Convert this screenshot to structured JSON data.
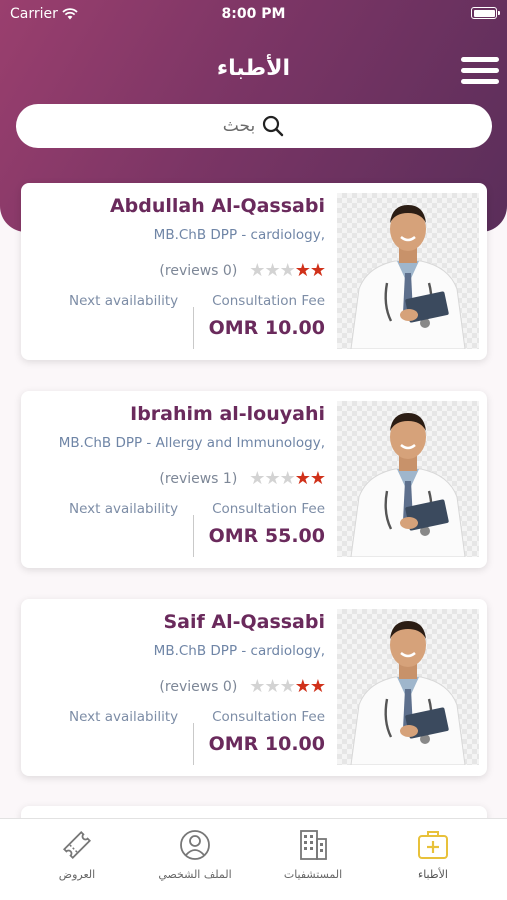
{
  "status_bar": {
    "carrier": "Carrier",
    "time": "8:00 PM"
  },
  "header": {
    "title": "الأطباء",
    "menu_icon": "hamburger-menu-icon"
  },
  "search": {
    "placeholder": "بحث",
    "icon": "search-icon"
  },
  "doctors": [
    {
      "name": "Abdullah Al-Qassabi",
      "specialty": "MB.ChB DPP - cardiology,",
      "stars": 2,
      "max_stars": 5,
      "reviews": "(reviews 0)",
      "fee_label": "Consultation Fee",
      "fee": "OMR 10.00",
      "availability_label": "Next availability"
    },
    {
      "name": "Ibrahim al-louyahi",
      "specialty": "MB.ChB DPP - Allergy and Immunology,",
      "stars": 2,
      "max_stars": 5,
      "reviews": "(reviews 1)",
      "fee_label": "Consultation Fee",
      "fee": "OMR 55.00",
      "availability_label": "Next availability"
    },
    {
      "name": "Saif Al-Qassabi",
      "specialty": "MB.ChB DPP - cardiology,",
      "stars": 2,
      "max_stars": 5,
      "reviews": "(reviews 0)",
      "fee_label": "Consultation Fee",
      "fee": "OMR 10.00",
      "availability_label": "Next availability"
    }
  ],
  "tabbar": {
    "items": [
      {
        "label": "العروض",
        "icon": "ticket-icon",
        "active": false
      },
      {
        "label": "الملف الشخصي",
        "icon": "profile-icon",
        "active": false
      },
      {
        "label": "المستشفيات",
        "icon": "hospital-building-icon",
        "active": false
      },
      {
        "label": "الأطباء",
        "icon": "medical-kit-icon",
        "active": true
      }
    ]
  },
  "colors": {
    "header_gradient_start": "#9a3f6e",
    "header_gradient_end": "#5a2e5a",
    "accent": "#6a2a5c",
    "star_on": "#d0311a",
    "star_off": "#d3d3d3",
    "tab_active_icon": "#e8c13a"
  }
}
